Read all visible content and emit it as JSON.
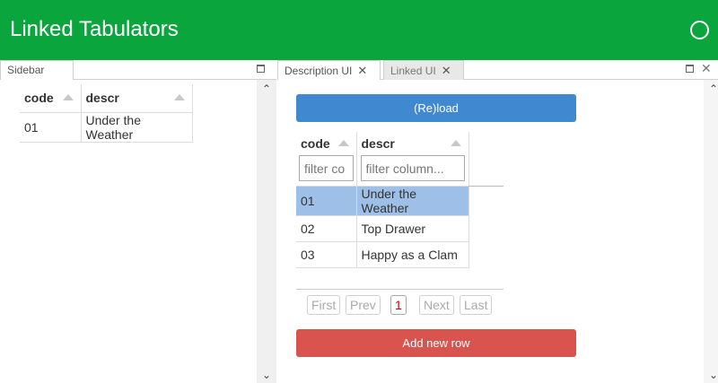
{
  "header": {
    "title": "Linked Tabulators"
  },
  "left_panel": {
    "tab_label": "Sidebar",
    "table": {
      "columns": [
        "code",
        "descr"
      ],
      "rows": [
        [
          "01",
          "Under the Weather"
        ]
      ]
    }
  },
  "right_panel": {
    "tabs": [
      {
        "label": "Description UI",
        "active": true
      },
      {
        "label": "Linked UI",
        "active": false
      }
    ],
    "reload_label": "(Re)load",
    "table": {
      "columns": [
        "code",
        "descr"
      ],
      "filter_placeholders": [
        "filter co",
        "filter column..."
      ],
      "rows": [
        [
          "01",
          "Under the Weather"
        ],
        [
          "02",
          "Top Drawer"
        ],
        [
          "03",
          "Happy as a Clam"
        ]
      ],
      "selected_row": 0
    },
    "pager": {
      "first": "First",
      "prev": "Prev",
      "page": "1",
      "next": "Next",
      "last": "Last"
    },
    "add_row_label": "Add new row"
  },
  "colors": {
    "header_bg": "#0aa63d",
    "reload_btn": "#4088cf",
    "add_btn": "#d9534f",
    "selected_row": "#9ebfe8"
  }
}
